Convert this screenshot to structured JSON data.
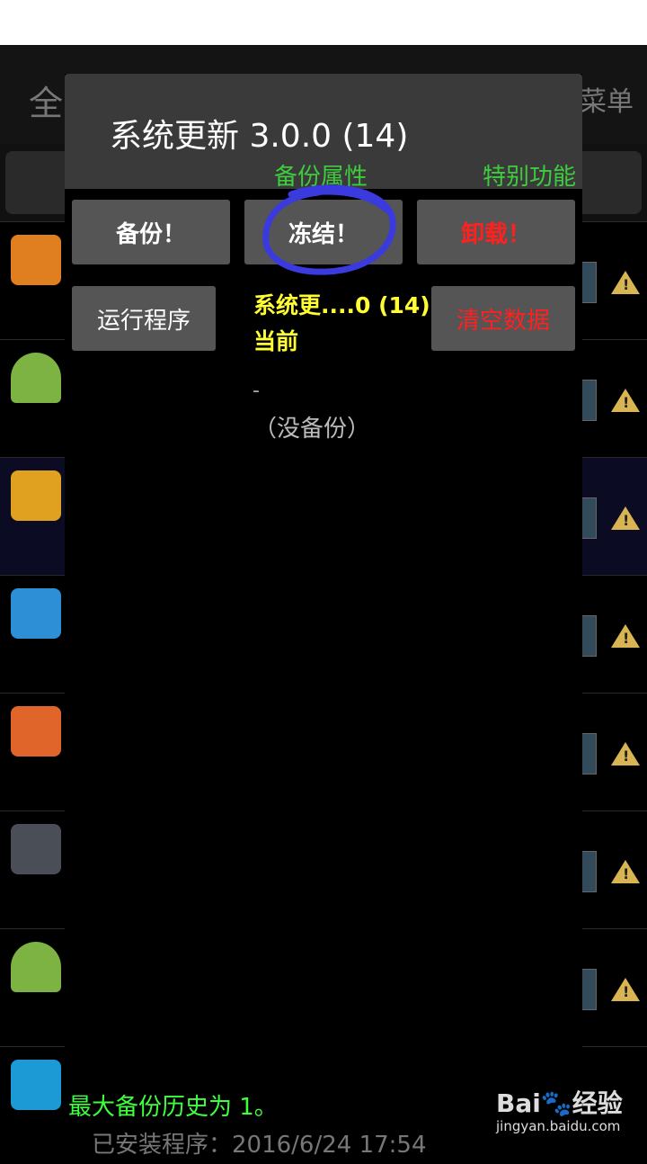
{
  "background": {
    "title_partial": "全",
    "menu_label": "菜单",
    "rows": [
      {
        "icon": "chat-bubble-icon",
        "color": "#e07f1f"
      },
      {
        "icon": "android-icon",
        "color": "#7cb342"
      },
      {
        "icon": "mi-icon",
        "color": "#e0a020"
      },
      {
        "icon": "arrow-up-icon",
        "color": "#2d8fd6"
      },
      {
        "icon": "home-icon",
        "color": "#e0652a"
      },
      {
        "icon": "scissors-icon",
        "color": "#4a4f57"
      },
      {
        "icon": "android-icon",
        "color": "#7cb342"
      },
      {
        "icon": "drop-icon",
        "color": "#1c9ad6"
      }
    ]
  },
  "dialog": {
    "title": "系统更新 3.0.0 (14)",
    "label_backup_properties": "备份属性",
    "label_special_functions": "特别功能",
    "buttons": {
      "backup": "备份！",
      "freeze": "冻结！",
      "uninstall": "卸载！",
      "run": "运行程序",
      "clear_data": "清空数据"
    },
    "info_name": "系统更....0 (14)",
    "info_state": "当前",
    "dash": "-",
    "no_backup": "（没备份）"
  },
  "footer": {
    "max_backup": "最大备份历史为 1。",
    "installed": "已安装程序：2016/6/24 17:54"
  },
  "watermark": {
    "logo": "Bai🐾经验",
    "site": "jingyan.baidu.com"
  },
  "colors": {
    "accent_green": "#3dcc3d",
    "warning_red": "#ff2020",
    "info_yellow": "#ffff33",
    "annotation_blue": "#3a3adf"
  }
}
